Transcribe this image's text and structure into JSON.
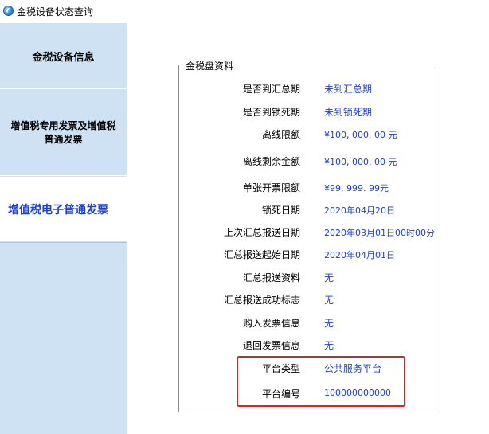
{
  "window": {
    "title": "金税设备状态查询"
  },
  "sidebar": {
    "items": [
      {
        "label": "金税设备信息"
      },
      {
        "label": "增值税专用发票及增值税普通发票"
      },
      {
        "label": "增值税电子普通发票",
        "selected": true
      }
    ]
  },
  "group": {
    "legend": "金税盘资料",
    "rows": [
      {
        "label": "是否到汇总期",
        "value": "未到汇总期"
      },
      {
        "label": "是否到锁死期",
        "value": "未到锁死期"
      },
      {
        "label": "离线限额",
        "value": "¥100, 000. 00 元"
      },
      {
        "label": "离线剩余金额",
        "value": "¥100, 000. 00 元"
      },
      {
        "label": "单张开票限额",
        "value": "¥99, 999. 99元"
      },
      {
        "label": "锁死日期",
        "value": "2020年04月20日"
      },
      {
        "label": "上次汇总报送日期",
        "value": "2020年03月01日00时00分"
      },
      {
        "label": "汇总报送起始日期",
        "value": "2020年04月01日"
      },
      {
        "label": "汇总报送资料",
        "value": "无"
      },
      {
        "label": "汇总报送成功标志",
        "value": "无"
      },
      {
        "label": "购入发票信息",
        "value": "无"
      },
      {
        "label": "退回发票信息",
        "value": "无"
      },
      {
        "label": "平台类型",
        "value": "公共服务平台"
      },
      {
        "label": "平台编号",
        "value": "100000000000"
      }
    ]
  },
  "colors": {
    "sidebar_bg": "#cfe2f3",
    "value_text": "#1c3fd6",
    "highlight_border": "#e02020"
  },
  "icons": {
    "app": "app-logo-icon"
  }
}
